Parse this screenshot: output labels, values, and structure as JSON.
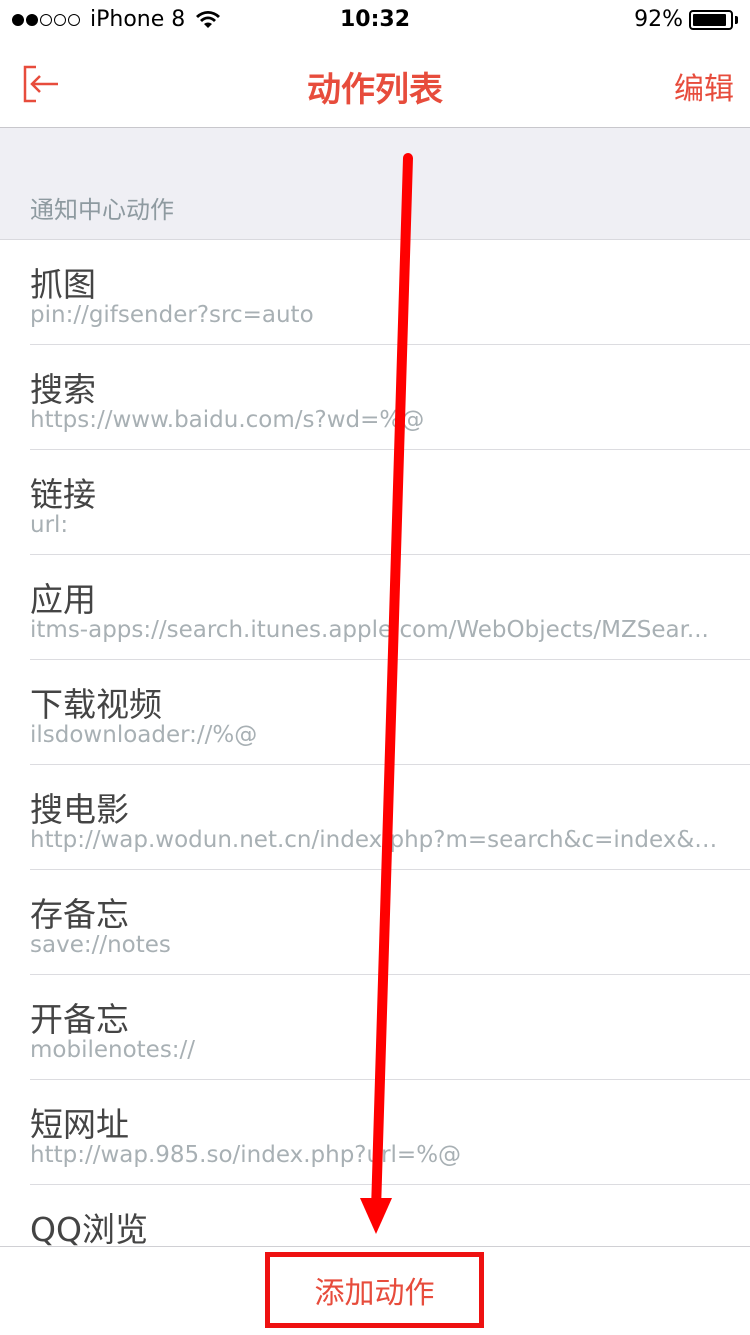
{
  "status_bar": {
    "carrier": "iPhone 8",
    "time": "10:32",
    "battery": "92%",
    "battery_level": 0.92,
    "signal_bars_filled": 2,
    "signal_bars_total": 5
  },
  "nav": {
    "title": "动作列表",
    "edit_label": "编辑",
    "back_icon": "back-arrow-icon"
  },
  "section": {
    "title": "通知中心动作"
  },
  "actions": [
    {
      "title": "抓图",
      "url": "pin://gifsender?src=auto"
    },
    {
      "title": "搜索",
      "url": "https://www.baidu.com/s?wd=%@"
    },
    {
      "title": "链接",
      "url": "url:"
    },
    {
      "title": "应用",
      "url": "itms-apps://search.itunes.apple.com/WebObjects/MZSear..."
    },
    {
      "title": "下载视频",
      "url": "ilsdownloader://%@"
    },
    {
      "title": "搜电影",
      "url": "http://wap.wodun.net.cn/index.php?m=search&c=index&a..."
    },
    {
      "title": "存备忘",
      "url": "save://notes"
    },
    {
      "title": "开备忘",
      "url": "mobilenotes://"
    },
    {
      "title": "短网址",
      "url": "http://wap.985.so/index.php?url=%@"
    },
    {
      "title": "QQ浏览",
      "url": ""
    }
  ],
  "bottom": {
    "add_label": "添加动作"
  },
  "colors": {
    "accent": "#e74c3c",
    "annotation": "#ff0000"
  }
}
